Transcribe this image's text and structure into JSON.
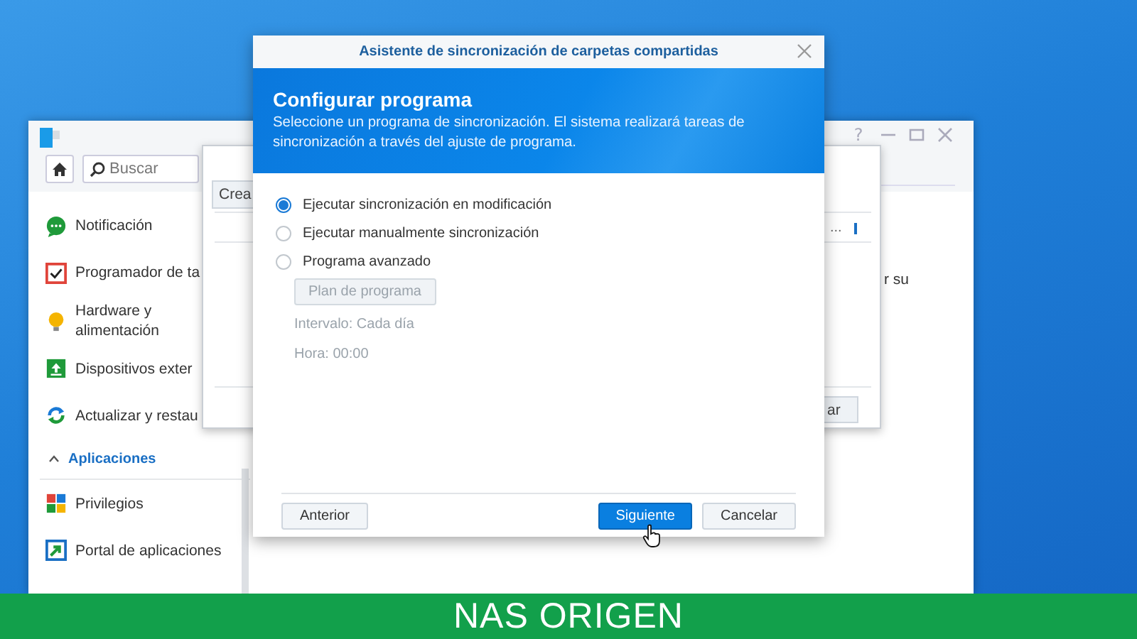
{
  "control_panel": {
    "help_button": "?",
    "search": {
      "placeholder": "Buscar"
    },
    "sidebar": {
      "items": [
        {
          "kind": "chat",
          "label": "Notificación"
        },
        {
          "kind": "calendar",
          "label": "Programador de ta"
        },
        {
          "kind": "bulb",
          "label": "Hardware y alimentación"
        },
        {
          "kind": "upload",
          "label": "Dispositivos exter"
        },
        {
          "kind": "refresh",
          "label": "Actualizar y restau"
        }
      ],
      "section": {
        "label": "Aplicaciones",
        "expanded": true
      },
      "section_items": [
        {
          "kind": "tiles",
          "label": "Privilegios"
        },
        {
          "kind": "portal",
          "label": "Portal de aplicaciones"
        }
      ]
    },
    "side_text": "r su"
  },
  "behind_window": {
    "create_button": "Crea",
    "column_text": "...",
    "bottom_button": "ar"
  },
  "dialog": {
    "title": "Asistente de sincronización de carpetas compartidas",
    "heading": "Configurar programa",
    "description": "Seleccione un programa de sincronización. El sistema realizará tareas de sincronización a través del ajuste de programa.",
    "options": [
      {
        "label": "Ejecutar sincronización en modificación",
        "selected": true
      },
      {
        "label": "Ejecutar manualmente sincronización",
        "selected": false
      },
      {
        "label": "Programa avanzado",
        "selected": false
      }
    ],
    "schedule": {
      "disabled": true,
      "button": "Plan de programa",
      "interval": "Intervalo: Cada día",
      "time": "Hora: 00:00"
    },
    "buttons": [
      {
        "label": "Anterior",
        "kind": "secondary"
      },
      {
        "label": "Siguiente",
        "kind": "primary"
      },
      {
        "label": "Cancelar",
        "kind": "secondary"
      }
    ]
  },
  "caption": "NAS ORIGEN"
}
